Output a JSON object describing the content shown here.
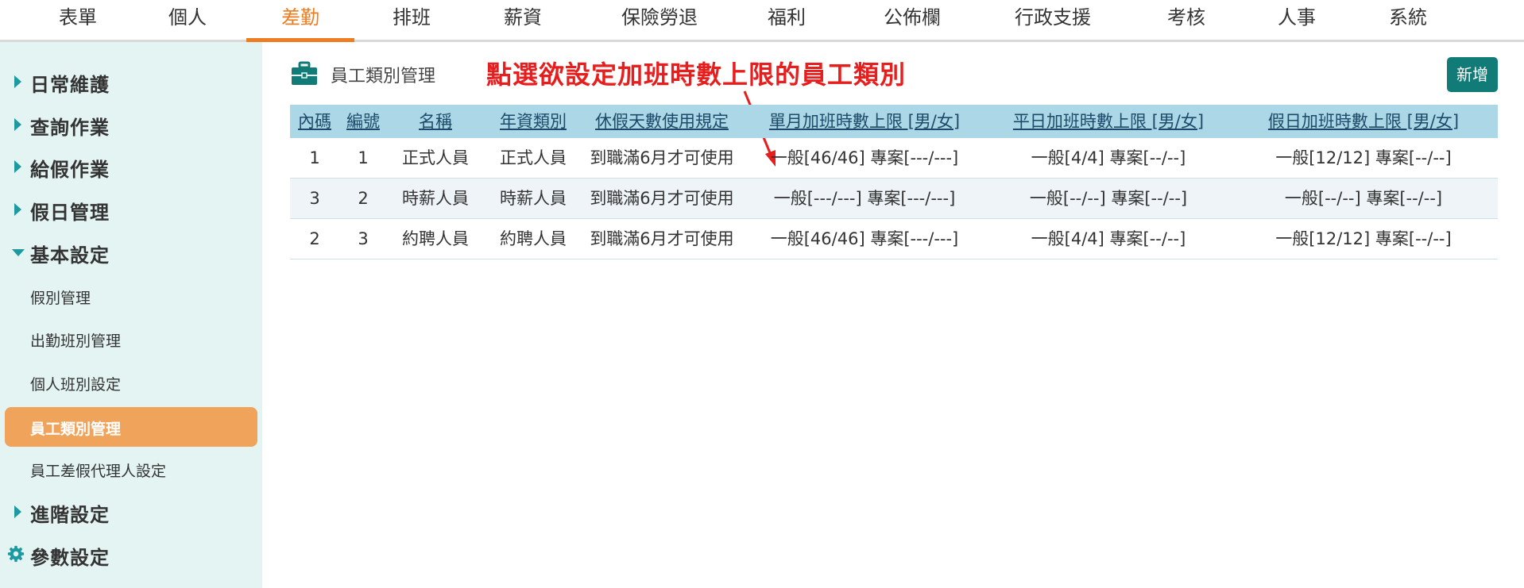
{
  "topnav": {
    "items": [
      "表單",
      "個人",
      "差勤",
      "排班",
      "薪資",
      "保險勞退",
      "福利",
      "公佈欄",
      "行政支援",
      "考核",
      "人事",
      "系統"
    ],
    "active_index": 2,
    "accent": "#ee7d22"
  },
  "sidebar": {
    "main": [
      "日常維護",
      "查詢作業",
      "給假作業",
      "假日管理",
      "基本設定",
      "進階設定",
      "參數設定"
    ],
    "sub": [
      "假別管理",
      "出勤班別管理",
      "個人班別設定",
      "員工類別管理",
      "員工差假代理人設定"
    ],
    "active_sub_index": 3
  },
  "page": {
    "icon": "briefcase-icon",
    "title": "員工類別管理",
    "annotation": "點選欲設定加班時數上限的員工類別",
    "add_button": "新增"
  },
  "table": {
    "headers": [
      "內碼",
      "編號",
      "名稱",
      "年資類別",
      "休假天數使用規定",
      "單月加班時數上限 [男/女]",
      "平日加班時數上限 [男/女]",
      "假日加班時數上限 [男/女]"
    ],
    "rows": [
      [
        "1",
        "1",
        "正式人員",
        "正式人員",
        "到職滿6月才可使用",
        "一般[46/46] 專案[---/---]",
        "一般[4/4] 專案[--/--]",
        "一般[12/12] 專案[--/--]"
      ],
      [
        "3",
        "2",
        "時薪人員",
        "時薪人員",
        "到職滿6月才可使用",
        "一般[---/---] 專案[---/---]",
        "一般[--/--] 專案[--/--]",
        "一般[--/--] 專案[--/--]"
      ],
      [
        "2",
        "3",
        "約聘人員",
        "約聘人員",
        "到職滿6月才可使用",
        "一般[46/46] 專案[---/---]",
        "一般[4/4] 專案[--/--]",
        "一般[12/12] 專案[--/--]"
      ]
    ]
  },
  "colors": {
    "sidebar_bg": "#e3f4f3",
    "active_sub_bg": "#f0a45b",
    "header_bg": "#abd7e7",
    "add_button_bg": "#117b78",
    "annotation": "#e61e1e"
  }
}
